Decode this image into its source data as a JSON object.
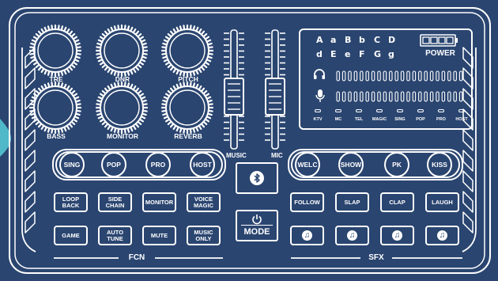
{
  "knobs": {
    "row1": [
      "TRE",
      "DNR",
      "PITCH"
    ],
    "row2": [
      "BASS",
      "MONITOR",
      "REVERB"
    ]
  },
  "faders": {
    "left_label": "MUSIC",
    "right_label": "MIC"
  },
  "bluetooth": {
    "icon": "bluetooth-icon"
  },
  "mode": {
    "label": "MODE",
    "icon": "power-icon"
  },
  "fcn_pill": [
    "SING",
    "POP",
    "PRO",
    "HOST"
  ],
  "sfx_pill": [
    "WELC",
    "SHOW",
    "PK",
    "KISS"
  ],
  "fcn_buttons": [
    [
      "LOOP",
      "BACK"
    ],
    [
      "SIDE",
      "CHAIN"
    ],
    [
      "MONITOR"
    ],
    [
      "VOICE",
      "MAGIC"
    ],
    [
      "GAME"
    ],
    [
      "AUTO",
      "TUNE"
    ],
    [
      "MUTE"
    ],
    [
      "MUSIC",
      "ONLY"
    ]
  ],
  "sfx_buttons": [
    "FOLLOW",
    "SLAP",
    "CLAP",
    "LAUGH"
  ],
  "sfx_note_buttons": {
    "count": 4,
    "icon": "music-note-icon"
  },
  "sections": {
    "fcn": "FCN",
    "sfx": "SFX"
  },
  "display": {
    "letters_row1": [
      "A",
      "a",
      "B",
      "b",
      "C",
      "D"
    ],
    "letters_row2": [
      "d",
      "E",
      "e",
      "F",
      "G",
      "g"
    ],
    "power_label": "POWER",
    "battery_icon": "battery-icon",
    "headphone_icon": "headphone-icon",
    "mic_icon": "microphone-icon",
    "indicators": [
      "KTV",
      "MC",
      "TEL",
      "MAGIC",
      "SING",
      "POP",
      "PRO",
      "HOST"
    ]
  },
  "colors": {
    "panel": "#2a4570",
    "lines": "#ffffff",
    "accent_teal": "#4fb8c9"
  }
}
